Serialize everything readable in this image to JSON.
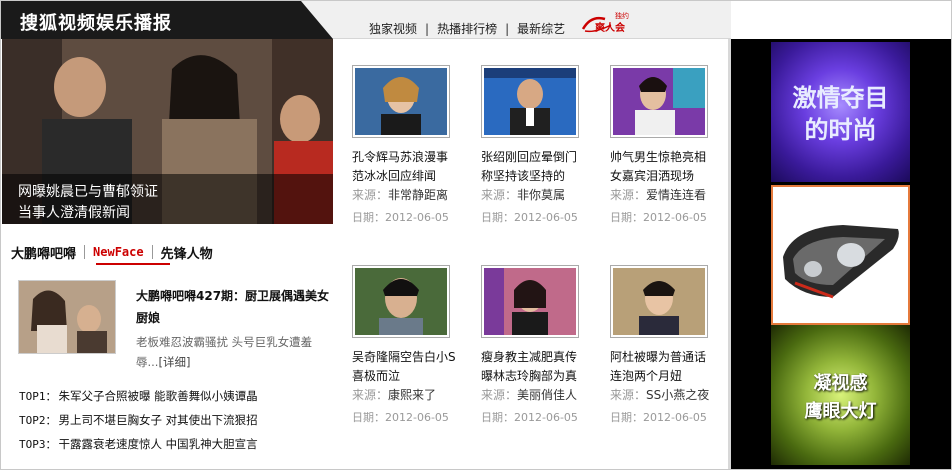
{
  "header": {
    "title": "搜狐视频娱乐播报",
    "nav": [
      "独家视频",
      "热播排行榜",
      "最新综艺"
    ],
    "logo_small": "独约",
    "logo_big": "爽人会"
  },
  "hero": {
    "caption_line1": "网曝姚晨已与曹郁领证",
    "caption_line2": "当事人澄清假新闻"
  },
  "left_tabs": [
    "大鹏嘚吧嘚",
    "NewFace",
    "先锋人物"
  ],
  "feature": {
    "title": "大鹏嘚吧嘚427期：厨卫展偶遇美女厨娘",
    "desc": "老板难忍波霸骚扰 头号巨乳女遭羞辱...",
    "more": "[详细]"
  },
  "top_list": [
    {
      "rank": "TOP1：",
      "text": "朱军父子合照被曝 能歌善舞似小姨谭晶"
    },
    {
      "rank": "TOP2：",
      "text": "男上司不堪巨胸女子 对其使出下流狠招"
    },
    {
      "rank": "TOP3：",
      "text": "干露露衰老速度惊人 中国乳神大胆宣言"
    }
  ],
  "cards": [
    {
      "title": "孔令辉马苏浪漫事范冰冰回应绯闻",
      "src_label": "来源：",
      "src": "非常静距离",
      "date": "日期：2012-06-05"
    },
    {
      "title": "张绍刚回应晕倒门称坚持该坚持的",
      "src_label": "来源：",
      "src": "非你莫属",
      "date": "日期：2012-06-05"
    },
    {
      "title": "帅气男生惊艳亮相女嘉宾泪洒现场",
      "src_label": "来源：",
      "src": "爱情连连看",
      "date": "日期：2012-06-05"
    },
    {
      "title": "吴奇隆隔空告白小S喜极而泣",
      "src_label": "来源：",
      "src": "康熙来了",
      "date": "日期：2012-06-05"
    },
    {
      "title": "瘦身教主减肥真传曝林志玲胸部为真",
      "src_label": "来源：",
      "src": "美丽俏佳人",
      "date": "日期：2012-06-05"
    },
    {
      "title": "阿杜被曝为普通话连泡两个月妞",
      "src_label": "来源：",
      "src": "SS小燕之夜",
      "date": "日期：2012-06-05"
    }
  ],
  "ad": {
    "top_text_1": "激情夺目",
    "top_text_2": "的时尚",
    "bottom_text_1": "凝视感",
    "bottom_text_2": "鹰眼大灯"
  }
}
